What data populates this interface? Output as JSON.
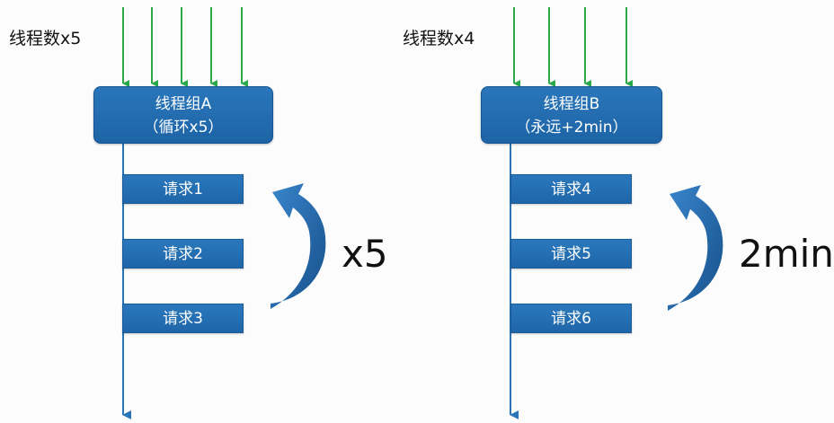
{
  "colors": {
    "box_fill": "#1f68ab",
    "timeline": "#2a74b8",
    "input_arrow": "#2aa84a",
    "loop_arrow": "#2566a8"
  },
  "groups": [
    {
      "thread_count_label": "线程数x5",
      "title": "线程组A",
      "subtitle": "（循环x5）",
      "requests": [
        "请求1",
        "请求2",
        "请求3"
      ],
      "loop_label": "x5"
    },
    {
      "thread_count_label": "线程数x4",
      "title": "线程组B",
      "subtitle": "（永远+2min）",
      "requests": [
        "请求4",
        "请求5",
        "请求6"
      ],
      "loop_label": "2min"
    }
  ]
}
